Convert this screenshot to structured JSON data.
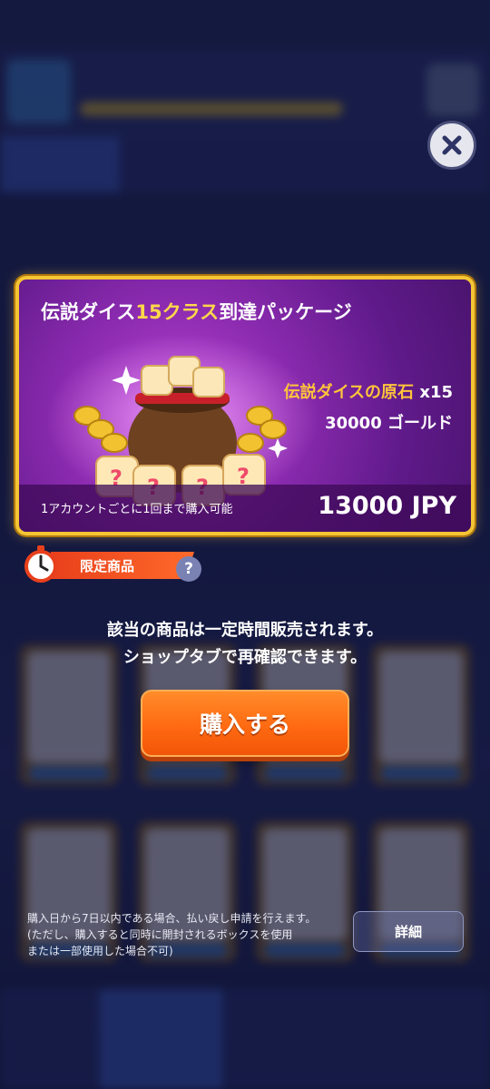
{
  "package": {
    "title_prefix": "伝説ダイス",
    "title_highlight": "15クラス",
    "title_suffix": "到達パッケージ",
    "items": [
      {
        "name": "伝説ダイスの原石",
        "count": "x15"
      },
      {
        "name": "30000 ゴールド"
      }
    ],
    "limit_note": "1アカウントごとに1回まで購入可能",
    "price": "13000 JPY"
  },
  "badge": {
    "label": "限定商品",
    "help": "?"
  },
  "notice": {
    "line1": "該当の商品は一定時間販売されます。",
    "line2": "ショップタブで再確認できます。"
  },
  "buy_button": {
    "label": "購入する"
  },
  "refund": {
    "line1": "購入日から7日以内である場合、払い戻し申請を行えます。",
    "line2": "(ただし、購入すると同時に開封されるボックスを使用",
    "line3": "または一部使用した場合不可)"
  },
  "detail_button": {
    "label": "詳細"
  },
  "colors": {
    "accent": "#ff6a12",
    "frame": "#f5c534",
    "panel": "#8c2bb0",
    "highlight": "#ffd84a"
  }
}
